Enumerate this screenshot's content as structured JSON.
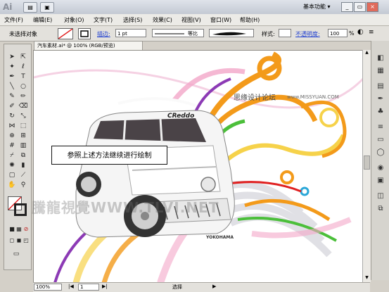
{
  "titlebar": {
    "app_logo": "Ai",
    "workspace": "基本功能",
    "buttons": [
      "▤",
      "▣"
    ],
    "window_controls": [
      "_",
      "▭",
      "×"
    ]
  },
  "menubar": {
    "items": [
      "文件(F)",
      "编辑(E)",
      "对象(O)",
      "文字(T)",
      "选择(S)",
      "效果(C)",
      "视图(V)",
      "窗口(W)",
      "帮助(H)"
    ]
  },
  "controlbar": {
    "selection": "未选择对象",
    "stroke_label": "描边:",
    "stroke_value": "1 pt",
    "profile": "等比",
    "style_label": "样式:",
    "opacity_label": "不透明度:",
    "opacity_value": "100",
    "opacity_unit": "%"
  },
  "document": {
    "tab_title": "汽车素材.ai* @ 100% (RGB/预览)",
    "callout": "参照上述方法继续进行绘制",
    "site_text": "思缘设计论坛",
    "site_url": "www.MISSYUAN.COM",
    "watermark": "騰龍視覺WWW.TLVI.NET",
    "car_brand": "CReddo",
    "tire_brand": "YOKOHAMA"
  },
  "statusbar": {
    "zoom": "100%",
    "page": "1",
    "tool": "选择"
  },
  "colors": {
    "orange": "#f39a1a",
    "purple": "#8c3ab5",
    "green": "#4bbf3a",
    "pink": "#f3a6c8",
    "yellow": "#f6d24a"
  }
}
